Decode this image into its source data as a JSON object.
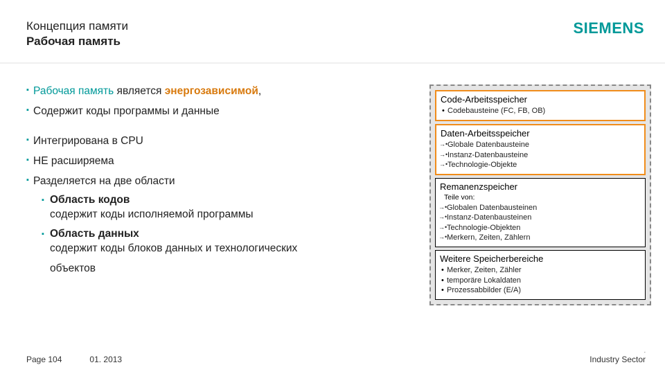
{
  "header": {
    "supertitle": "Концепция памяти",
    "title": "Рабочая память",
    "logo": "SIEMENS"
  },
  "bullets": {
    "b1": {
      "pre": "Рабочая память",
      "mid": " является ",
      "em": "энергозависимой",
      "post": ","
    },
    "b2": "Содержит коды программы и данные",
    "b3": "Интегрирована в CPU",
    "b4": "НЕ расширяема",
    "b5": "Разделяется на две области",
    "s1t": "Область кодов",
    "s1d": "содержит коды исполняемой программы",
    "s2t": "Область данных",
    "s2d": "содержит коды блоков данных и технологических",
    "s2d2": "объектов"
  },
  "diagram": {
    "box1": {
      "title": "Code-Arbeitsspeicher",
      "items": [
        "Codebausteine (FC, FB, OB)"
      ]
    },
    "box2": {
      "title": "Daten-Arbeitsspeicher",
      "items": [
        "Globale Datenbausteine",
        "Instanz-Datenbausteine",
        "Technologie-Objekte"
      ]
    },
    "box3": {
      "title": "Remanenzspeicher",
      "sub": "Teile von:",
      "items": [
        "Globalen Datenbausteinen",
        "Instanz-Datenbausteinen",
        "Technologie-Objekten",
        "Merkern, Zeiten, Zählern"
      ]
    },
    "box4": {
      "title": "Weitere Speicherbereiche",
      "items": [
        "Merker, Zeiten, Zähler",
        "temporäre Lokaldaten",
        "Prozessabbilder (E/A)"
      ]
    }
  },
  "footer": {
    "page": "Page 104",
    "date": "01. 2013",
    "sector": "Industry Sector"
  }
}
